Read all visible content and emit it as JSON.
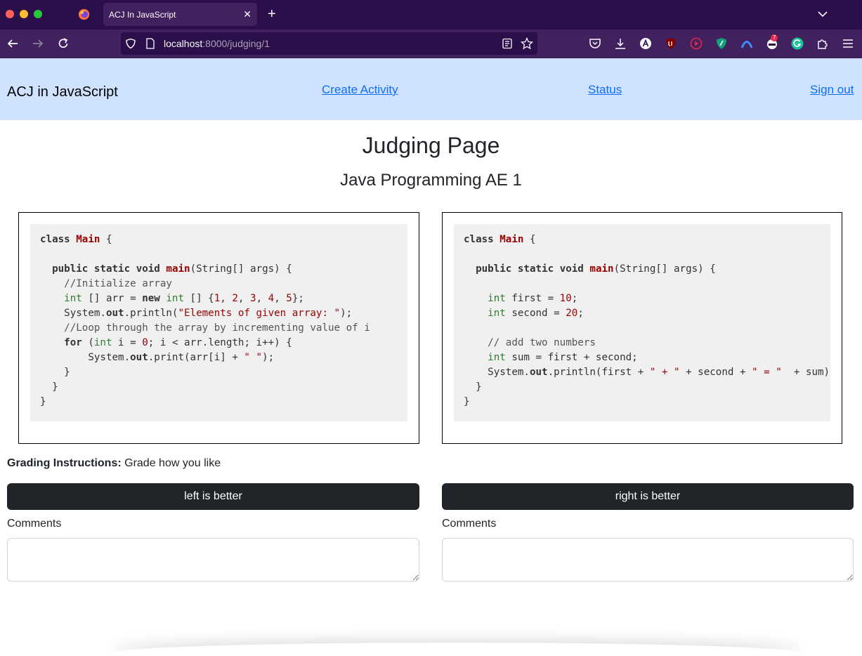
{
  "browser": {
    "tab_title": "ACJ In JavaScript",
    "tab_close": "✕",
    "new_tab": "+",
    "url_host": "localhost",
    "url_path": ":8000/judging/1",
    "ext_badge": "7"
  },
  "header": {
    "brand": "ACJ in JavaScript",
    "links": [
      "Create Activity",
      "Status",
      "Sign out"
    ]
  },
  "page": {
    "title": "Judging Page",
    "activity": "Java Programming AE 1"
  },
  "left_code": [
    "class Main {",
    "",
    "  public static void main(String[] args) {",
    "    //Initialize array",
    "    int [] arr = new int [] {1, 2, 3, 4, 5};",
    "    System.out.println(\"Elements of given array: \");",
    "    //Loop through the array by incrementing value of i",
    "    for (int i = 0; i < arr.length; i++) {",
    "        System.out.print(arr[i] + \" \");",
    "    }",
    "  }",
    "}"
  ],
  "right_code": [
    "class Main {",
    "",
    "  public static void main(String[] args) {",
    "",
    "    int first = 10;",
    "    int second = 20;",
    "",
    "    // add two numbers",
    "    int sum = first + second;",
    "    System.out.println(first + \" + \" + second + \" = \"  + sum);",
    "  }",
    "}"
  ],
  "grading": {
    "label": "Grading Instructions:",
    "text": "Grade how you like"
  },
  "actions": {
    "left_button": "left is better",
    "right_button": "right is better",
    "comments_label": "Comments"
  },
  "colors": {
    "header_bg": "#cfe2ff",
    "button_bg": "#212529",
    "link": "#0d6efd",
    "browser_dark": "#2b0f4a",
    "browser_mid": "#42215f"
  }
}
